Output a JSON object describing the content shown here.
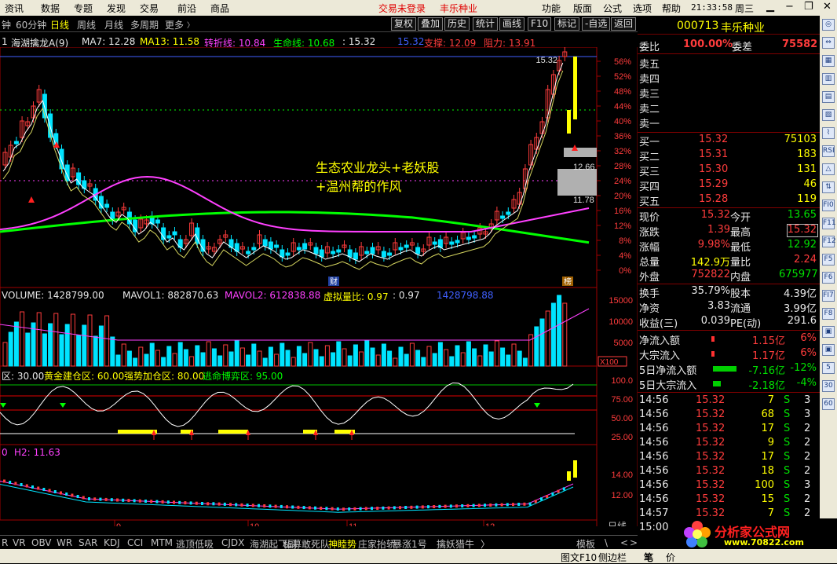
{
  "menubar": {
    "items": [
      "资讯",
      "数据",
      "专题",
      "发现",
      "交易",
      "前沿",
      "商品"
    ],
    "status_center": "交易未登录",
    "stock_center": "丰乐种业",
    "right_items": [
      "功能",
      "版面",
      "公式",
      "选项",
      "帮助"
    ],
    "clock": "21:33:58",
    "weekday": "周三"
  },
  "toolbar": {
    "tabs": [
      "钟",
      "60分钟",
      "日线",
      "周线",
      "月线",
      "多周期",
      "更多"
    ],
    "selected": "日线",
    "buttons": [
      "复权",
      "叠加",
      "历史",
      "统计",
      "画线",
      "F10",
      "标记",
      "-自选",
      "返回"
    ]
  },
  "ind_main": {
    "prefix": "1",
    "name": "海湖擒龙A(9)",
    "ma7": "MA7: 12.28",
    "ma13": "MA13: 11.58",
    "turn": "转折线: 10.84",
    "life": "生命线: 10.68",
    "val": ": 15.32",
    "v2": "15.32",
    "support": "支撑: 12.09",
    "resist": "阻力: 13.91"
  },
  "annot": {
    "line1": "生态农业龙头+老妖股",
    "line2": "+温州帮的作风",
    "price_hi": "15.32",
    "price_mid": "12.66",
    "price_lo": "11.78",
    "mark_cai": "财",
    "mark_bang": "榜"
  },
  "price_axis": [
    "56%",
    "52%",
    "48%",
    "44%",
    "40%",
    "36%",
    "32%",
    "28%",
    "24%",
    "20%",
    "16%",
    "12%",
    "8%",
    "4%",
    "0%"
  ],
  "vol": {
    "label": "VOLUME: 1428799.00",
    "mavol1": "MAVOL1: 882870.63",
    "mavol2": "MAVOL2: 612838.88",
    "virt": "虚拟量比: 0.97",
    "v2": ": 0.97",
    "v3": "1428798.88",
    "axis": [
      "15000",
      "10000",
      "5000"
    ],
    "unit": "X100"
  },
  "osc": {
    "a": "区: 30.00",
    "b": "黄金建仓区: 60.00",
    "c": "强势加仓区: 80.00",
    "d": "逃命博弈区: 95.00",
    "axis": [
      "100.0",
      "75.00",
      "50.00",
      "25.00"
    ]
  },
  "h2": {
    "label": "H2: 11.63",
    "axis": [
      "14.00",
      "12.00"
    ]
  },
  "xaxis": {
    "labels": [
      "9",
      "10",
      "11",
      "12"
    ],
    "period": "日线"
  },
  "bottom_tabs": [
    "R",
    "VR",
    "OBV",
    "WR",
    "SAR",
    "KDJ",
    "CCI",
    "MTM",
    "逃顶低吸",
    "CJDX",
    "海湖起飞副",
    "私募敢死队",
    "神睦势",
    "庄家抬轿",
    "暴涨1号",
    "擒妖猎牛",
    "〉",
    "模板",
    "\\",
    "<",
    ">"
  ],
  "bottom_sel": "神睦势",
  "quote": {
    "code": "000713",
    "name": "丰乐种业",
    "weibi": "委比",
    "weibi_v": "100.00%",
    "weicha": "委差",
    "weicha_v": "75582",
    "sell": [
      "卖五",
      "卖四",
      "卖三",
      "卖二",
      "卖一"
    ],
    "buy": [
      {
        "l": "买一",
        "p": "15.32",
        "v": "75103"
      },
      {
        "l": "买二",
        "p": "15.31",
        "v": "183"
      },
      {
        "l": "买三",
        "p": "15.30",
        "v": "131"
      },
      {
        "l": "买四",
        "p": "15.29",
        "v": "46"
      },
      {
        "l": "买五",
        "p": "15.28",
        "v": "119"
      }
    ],
    "stats": [
      {
        "a": "现价",
        "av": "15.32",
        "b": "今开",
        "bv": "13.65"
      },
      {
        "a": "涨跌",
        "av": "1.39",
        "b": "最高",
        "bv": "15.32"
      },
      {
        "a": "涨幅",
        "av": "9.98%",
        "b": "最低",
        "bv": "12.92"
      },
      {
        "a": "总量",
        "av": "142.9万",
        "b": "量比",
        "bv": "2.24"
      },
      {
        "a": "外盘",
        "av": "752822",
        "b": "内盘",
        "bv": "675977"
      }
    ],
    "stats2": [
      {
        "a": "换手",
        "av": "35.79%",
        "b": "股本",
        "bv": "4.39亿"
      },
      {
        "a": "净资",
        "av": "3.83",
        "b": "流通",
        "bv": "3.99亿"
      },
      {
        "a": "收益(三)",
        "av": "0.039",
        "b": "PE(动)",
        "bv": "291.6"
      }
    ],
    "flow": [
      {
        "l": "净流入额",
        "v": "1.15亿",
        "p": "6%"
      },
      {
        "l": "大宗流入",
        "v": "1.17亿",
        "p": "6%"
      },
      {
        "l": "5日净流入额",
        "v": "-7.16亿",
        "p": "-12%"
      },
      {
        "l": "5日大宗流入",
        "v": "-2.18亿",
        "p": "-4%"
      }
    ],
    "ticks": [
      {
        "t": "14:56",
        "p": "15.32",
        "v": "7",
        "s": "S",
        "n": "3"
      },
      {
        "t": "14:56",
        "p": "15.32",
        "v": "68",
        "s": "S",
        "n": "3"
      },
      {
        "t": "14:56",
        "p": "15.32",
        "v": "17",
        "s": "S",
        "n": "2"
      },
      {
        "t": "14:56",
        "p": "15.32",
        "v": "9",
        "s": "S",
        "n": "2"
      },
      {
        "t": "14:56",
        "p": "15.32",
        "v": "17",
        "s": "S",
        "n": "2"
      },
      {
        "t": "14:56",
        "p": "15.32",
        "v": "18",
        "s": "S",
        "n": "2"
      },
      {
        "t": "14:56",
        "p": "15.32",
        "v": "100",
        "s": "S",
        "n": "3"
      },
      {
        "t": "14:56",
        "p": "15.32",
        "v": "15",
        "s": "S",
        "n": "2"
      },
      {
        "t": "14:57",
        "p": "15.32",
        "v": "7",
        "s": "S",
        "n": "2"
      },
      {
        "t": "15:00",
        "p": "",
        "v": "",
        "s": "",
        "n": ""
      }
    ]
  },
  "right_tools": [
    "◎",
    "⇔",
    "▦",
    "▥",
    "▤",
    "▧",
    "⌇",
    "RSI",
    "△",
    "⇅",
    "FI0",
    "F11",
    "F12",
    "F5",
    "F6",
    "FI7",
    "F8",
    "▣",
    "▣",
    "5",
    "30",
    "60"
  ],
  "statusbar": {
    "left": "图文F10",
    "mid": "侧边栏",
    "r1": "笔",
    "r2": "价"
  },
  "watermark": {
    "line1": "分析家公式网",
    "line2": "www.70822.com"
  }
}
